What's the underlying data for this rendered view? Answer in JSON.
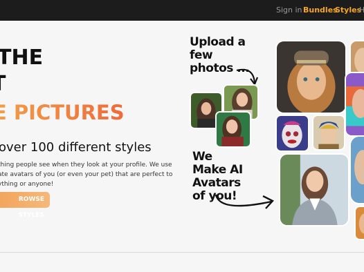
{
  "nav": {
    "signin": "Sign in",
    "bundles": "Bundles",
    "styles": "Styles",
    "partial": "H"
  },
  "hero": {
    "line1": "THE",
    "line2": "T",
    "line3": "E PICTURES",
    "subtitle": "over 100 different styles",
    "desc1": "thing people see when they look at your profile. We use",
    "desc2": "ate avatars of you (or even your pet) that are perfect to",
    "desc3": "ything or anyone!",
    "button": "ROWSE STYLES"
  },
  "collage": {
    "upload_text": [
      "Upload a",
      "few",
      "photos ..."
    ],
    "make_text": [
      "We",
      "Make AI",
      "Avatars",
      "of you!"
    ]
  },
  "colors": {
    "accent": "#f5a623",
    "topbar": "#1c1c1c",
    "hero_orange": "#f07a3a"
  }
}
